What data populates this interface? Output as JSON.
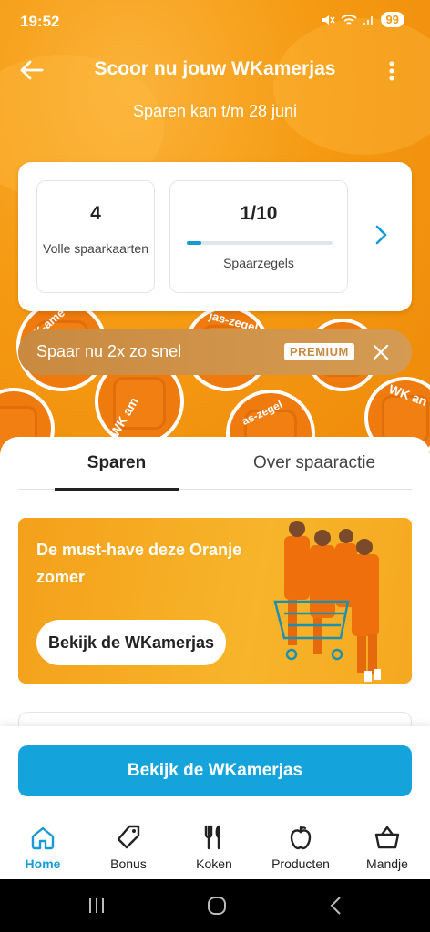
{
  "status_bar": {
    "time": "19:52",
    "battery": "99",
    "icons": [
      "mute-icon",
      "wifi-icon",
      "signal-icon"
    ]
  },
  "header": {
    "title": "Scoor nu jouw WKamerjas",
    "subtitle": "Sparen kan t/m 28 juni"
  },
  "savings": {
    "cards": {
      "value": "4",
      "label": "Volle spaarkaarten"
    },
    "stamps": {
      "value": "1/10",
      "label": "Spaarzegels",
      "progress": 0.1
    }
  },
  "premium_banner": {
    "text": "Spaar nu 2x zo snel",
    "badge": "PREMIUM"
  },
  "stamps_decor": {
    "texts": [
      "WK-ame",
      "jas-zegel",
      "WK am",
      "WK an",
      "as-zegel"
    ]
  },
  "tabs": [
    {
      "label": "Sparen",
      "active": true
    },
    {
      "label": "Over spaaractie",
      "active": false
    }
  ],
  "promo": {
    "title": "De must-have deze Oranje zomer",
    "button": "Bekijk de WKamerjas"
  },
  "cta": {
    "label": "Bekijk de WKamerjas"
  },
  "bottom_nav": [
    {
      "label": "Home",
      "icon": "home-icon",
      "active": true
    },
    {
      "label": "Bonus",
      "icon": "bonus-tag-icon",
      "active": false
    },
    {
      "label": "Koken",
      "icon": "cutlery-icon",
      "active": false
    },
    {
      "label": "Producten",
      "icon": "apple-icon",
      "active": false
    },
    {
      "label": "Mandje",
      "icon": "basket-icon",
      "active": false
    }
  ],
  "colors": {
    "orange": "#f59a12",
    "blue": "#15a3dc",
    "premium": "#c98a40"
  }
}
